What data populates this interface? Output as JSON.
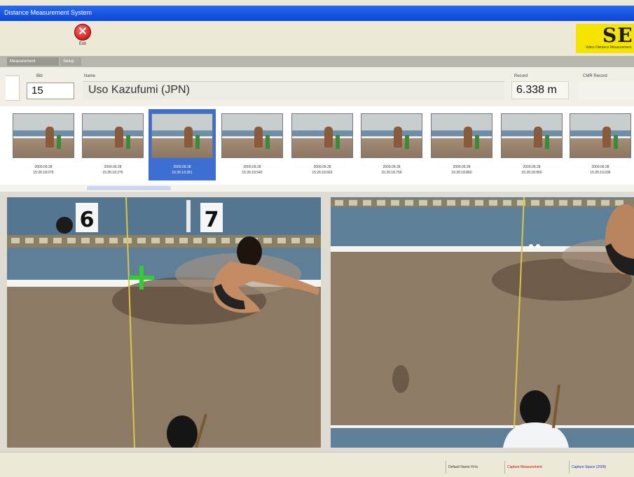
{
  "window": {
    "title": "Distance Measurement System"
  },
  "toolbar": {
    "exit_label": "Exit",
    "brand_logo": "SE",
    "brand_subtitle": "Video Distance Measurement"
  },
  "tabs": [
    {
      "label": "Measurement"
    },
    {
      "label": "Setup"
    }
  ],
  "athlete": {
    "bib_label": "Bib",
    "bib": "15",
    "name_label": "Name",
    "name": "Uso Kazufumi (JPN)",
    "record_label": "Record",
    "record": "6.338 m",
    "cmr_label": "CMR Record",
    "cmr": ""
  },
  "thumbnails": [
    {
      "date": "2009.09.28",
      "time": "15:26:18.075"
    },
    {
      "date": "2009.09.28",
      "time": "15:26:18.275"
    },
    {
      "date": "2009.09.28",
      "time": "15:26:18.351"
    },
    {
      "date": "2009.09.28",
      "time": "15:26:18.540"
    },
    {
      "date": "2009.09.28",
      "time": "15:26:18.663"
    },
    {
      "date": "2009.09.28",
      "time": "15:26:18.756"
    },
    {
      "date": "2009.09.28",
      "time": "15:26:18.860"
    },
    {
      "date": "2009.09.28",
      "time": "15:26:18.950"
    },
    {
      "date": "2009.09.28",
      "time": "15:26:19.036"
    }
  ],
  "selected_thumbnail_index": 2,
  "views": {
    "left_marker_6": "6",
    "left_marker_7": "7"
  },
  "status": {
    "cell1": "Default Name Hi-lo",
    "cell2": "Capture Measurement",
    "cell3": "Capture Space (2009)"
  },
  "colors": {
    "titlebar": "#0a46d6",
    "brand_bg": "#f5e400",
    "selected_thumb": "#3c6fd1",
    "exit_red": "#c40000",
    "status_red": "#d60000",
    "status_blue": "#1030c0"
  }
}
